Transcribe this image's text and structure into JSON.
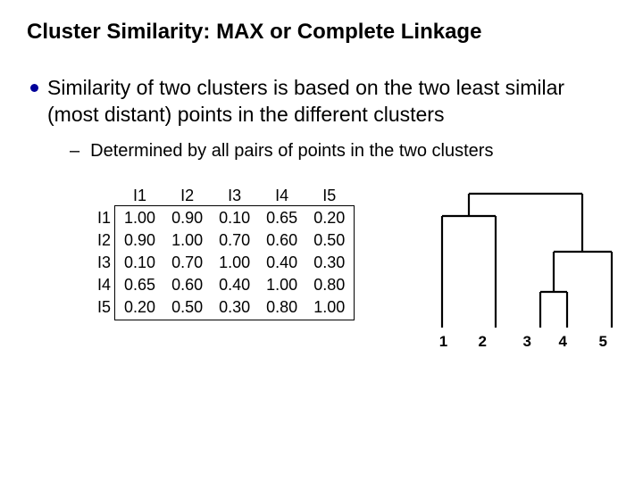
{
  "title": "Cluster Similarity: MAX or Complete Linkage",
  "bullet1": "Similarity of two clusters is based on the two least similar (most distant) points in the different clusters",
  "sub1": "Determined by all pairs of points in the two clusters",
  "matrix": {
    "cols": [
      "I1",
      "I2",
      "I3",
      "I4",
      "I5"
    ],
    "rows": [
      "I1",
      "I2",
      "I3",
      "I4",
      "I5"
    ],
    "data": [
      [
        "1.00",
        "0.90",
        "0.10",
        "0.65",
        "0.20"
      ],
      [
        "0.90",
        "1.00",
        "0.70",
        "0.60",
        "0.50"
      ],
      [
        "0.10",
        "0.70",
        "1.00",
        "0.40",
        "0.30"
      ],
      [
        "0.65",
        "0.60",
        "0.40",
        "1.00",
        "0.80"
      ],
      [
        "0.20",
        "0.50",
        "0.30",
        "0.80",
        "1.00"
      ]
    ]
  },
  "dendro_labels": [
    "1",
    "2",
    "3",
    "4",
    "5"
  ],
  "chart_data": {
    "type": "table",
    "title": "Similarity matrix",
    "categories": [
      "I1",
      "I2",
      "I3",
      "I4",
      "I5"
    ],
    "series": [
      {
        "name": "I1",
        "values": [
          1.0,
          0.9,
          0.1,
          0.65,
          0.2
        ]
      },
      {
        "name": "I2",
        "values": [
          0.9,
          1.0,
          0.7,
          0.6,
          0.5
        ]
      },
      {
        "name": "I3",
        "values": [
          0.1,
          0.7,
          1.0,
          0.4,
          0.3
        ]
      },
      {
        "name": "I4",
        "values": [
          0.65,
          0.6,
          0.4,
          1.0,
          0.8
        ]
      },
      {
        "name": "I5",
        "values": [
          0.2,
          0.5,
          0.3,
          0.8,
          1.0
        ]
      }
    ],
    "dendrogram": {
      "leaves": [
        1,
        2,
        3,
        4,
        5
      ],
      "merges": [
        {
          "left": [
            3
          ],
          "right": [
            4
          ],
          "height": 1
        },
        {
          "left": [
            3,
            4
          ],
          "right": [
            5
          ],
          "height": 2
        },
        {
          "left": [
            1
          ],
          "right": [
            2
          ],
          "height": 3
        },
        {
          "left": [
            1,
            2
          ],
          "right": [
            3,
            4,
            5
          ],
          "height": 4
        }
      ]
    }
  }
}
